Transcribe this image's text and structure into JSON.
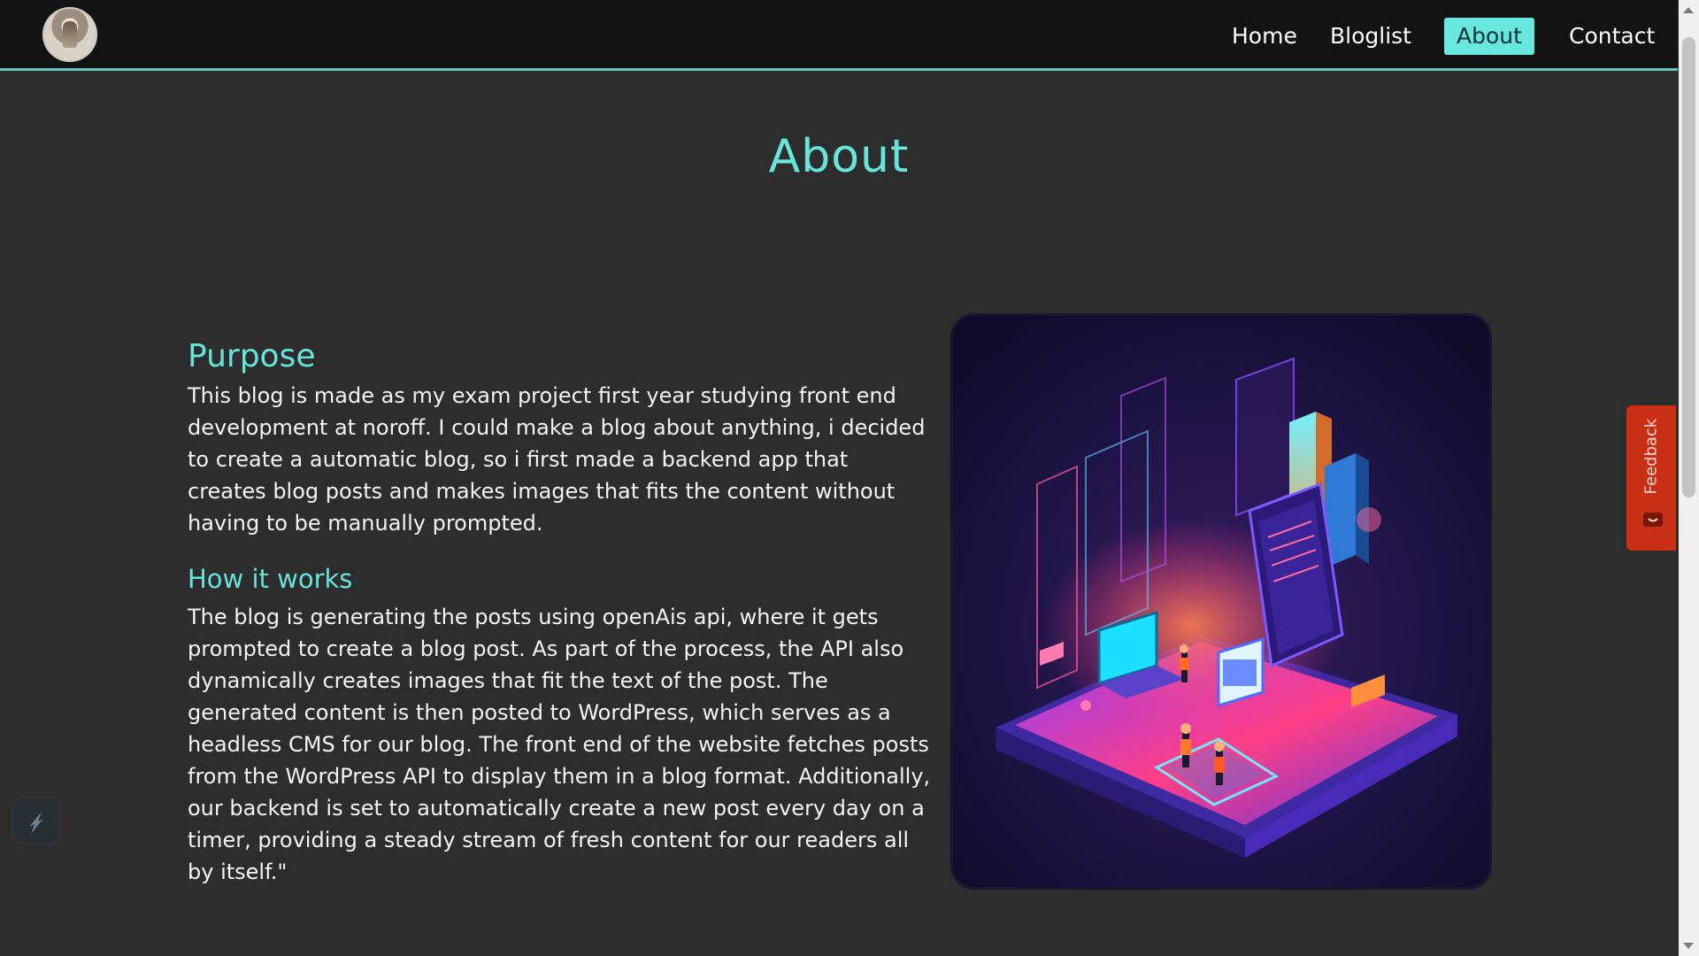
{
  "nav": {
    "items": [
      {
        "label": "Home"
      },
      {
        "label": "Bloglist"
      },
      {
        "label": "About",
        "active": true
      },
      {
        "label": "Contact"
      }
    ]
  },
  "page": {
    "title": "About"
  },
  "purpose": {
    "heading": "Purpose",
    "text": "This blog is made as my exam project first year studying front end development at noroff. I could make a blog about anything, i decided to create a automatic blog, so i first made a backend app that creates blog posts and makes images that fits the content without having to be manually prompted."
  },
  "how": {
    "heading": "How it works",
    "text": "The blog is generating the posts using openAis api, where it gets prompted to create a blog post. As part of the process, the API also dynamically creates images that fit the text of the post. The generated content is then posted to WordPress, which serves as a headless CMS for our blog. The front end of the website fetches posts from the WordPress API to display them in a blog format. Additionally, our backend is set to automatically create a new post every day on a timer, providing a steady stream of fresh content for our readers all by itself.\""
  },
  "feedback": {
    "label": "Feedback"
  },
  "colors": {
    "accent": "#67e4dc",
    "feedback": "#c92f14",
    "background": "#2d2d2d",
    "navbar": "#131313"
  },
  "icons": [
    "logo-avatar",
    "feedback-icon",
    "bolt-widget-icon"
  ]
}
